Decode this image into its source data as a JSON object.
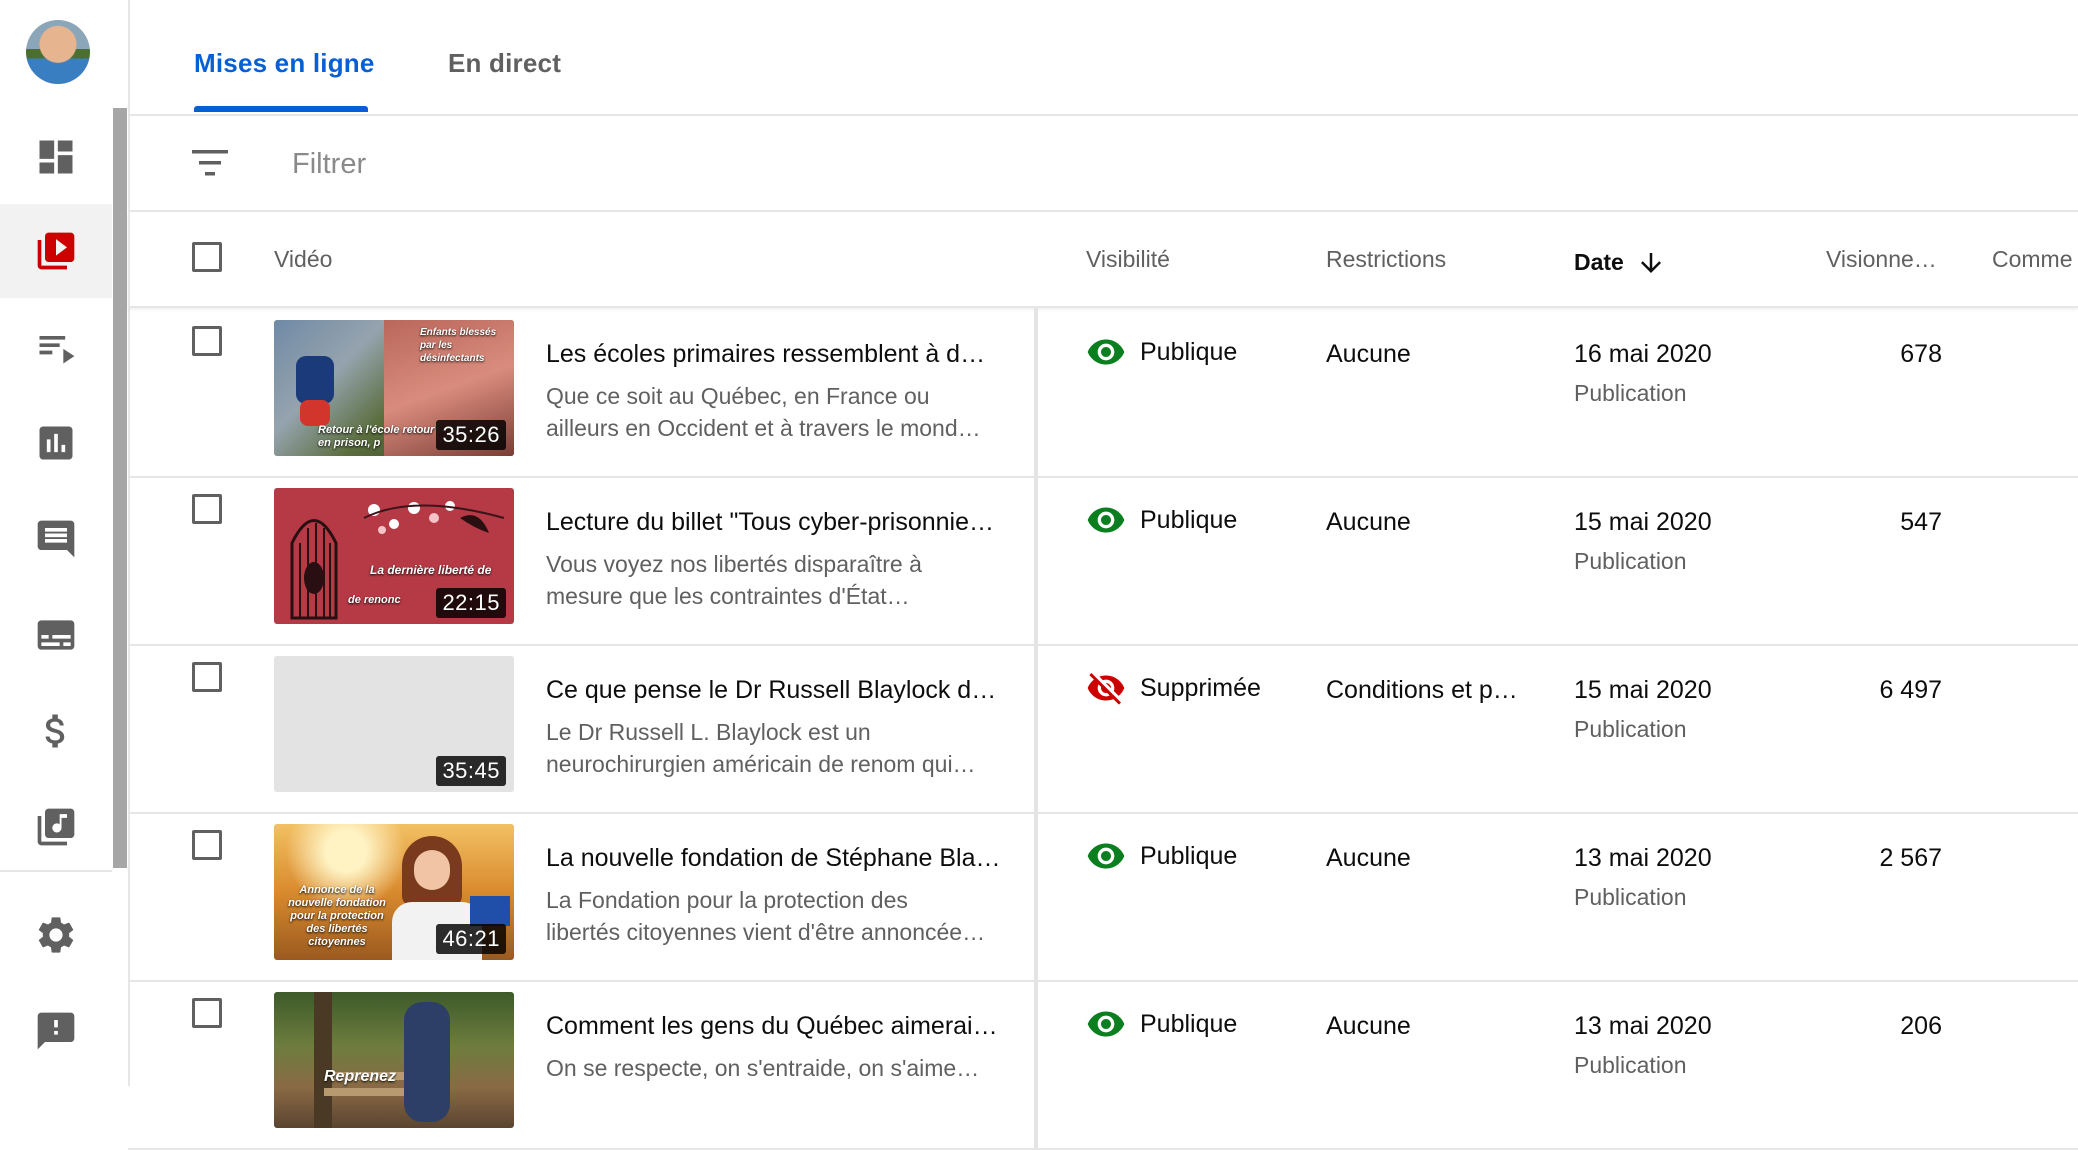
{
  "nav": {
    "items": [
      {
        "name": "dashboard",
        "icon": "dashboard-icon"
      },
      {
        "name": "content",
        "icon": "video-library-icon",
        "active": true
      },
      {
        "name": "playlists",
        "icon": "playlist-icon"
      },
      {
        "name": "analytics",
        "icon": "analytics-icon"
      },
      {
        "name": "comments",
        "icon": "comments-icon"
      },
      {
        "name": "subtitles",
        "icon": "subtitles-icon"
      },
      {
        "name": "monetization",
        "icon": "dollar-icon"
      },
      {
        "name": "audio-library",
        "icon": "audio-library-icon"
      },
      {
        "name": "settings",
        "icon": "gear-icon"
      },
      {
        "name": "feedback",
        "icon": "feedback-icon"
      }
    ]
  },
  "tabs": [
    {
      "label": "Mises en ligne",
      "active": true
    },
    {
      "label": "En direct",
      "active": false
    }
  ],
  "filter": {
    "placeholder": "Filtrer",
    "icon": "filter-icon"
  },
  "table": {
    "headers": {
      "video": "Vidéo",
      "visibility": "Visibilité",
      "restrictions": "Restrictions",
      "date": "Date",
      "views": "Visionne…",
      "comments": "Comme"
    },
    "rows": [
      {
        "title": "Les écoles primaires ressemblent à d…",
        "desc1": "Que ce soit au Québec, en France ou",
        "desc2": "ailleurs en Occident et à travers le mond…",
        "duration": "35:26",
        "visibility": "Publique",
        "restrictions": "Aucune",
        "date": "16 mai 2020",
        "date_sub": "Publication",
        "views": "678",
        "thumb_caption_1": "Enfants blessés par les désinfectants",
        "thumb_caption_2": "Retour à l'école retour en prison, p"
      },
      {
        "title": "Lecture du billet \"Tous cyber-prisonnie…",
        "desc1": "Vous voyez nos libertés disparaître à",
        "desc2": "mesure que les contraintes d'État…",
        "duration": "22:15",
        "visibility": "Publique",
        "restrictions": "Aucune",
        "date": "15 mai 2020",
        "date_sub": "Publication",
        "views": "547",
        "thumb_caption_1": "La dernière liberté de",
        "thumb_caption_2": "de renonc"
      },
      {
        "title": "Ce que pense le Dr Russell Blaylock d…",
        "desc1": "Le Dr Russell L. Blaylock est un",
        "desc2": "neurochirurgien américain de renom qui…",
        "duration": "35:45",
        "visibility": "Supprimée",
        "restrictions": "Conditions et p…",
        "date": "15 mai 2020",
        "date_sub": "Publication",
        "views": "6 497"
      },
      {
        "title": "La nouvelle fondation de Stéphane Bla…",
        "desc1": "La Fondation pour la protection des",
        "desc2": "libertés citoyennes vient d'être annoncée…",
        "duration": "46:21",
        "visibility": "Publique",
        "restrictions": "Aucune",
        "date": "13 mai 2020",
        "date_sub": "Publication",
        "views": "2 567",
        "thumb_caption_1": "Annonce de la nouvelle fondation pour la protection des libertés citoyennes"
      },
      {
        "title": "Comment les gens du Québec aimerai…",
        "desc1": "On se respecte, on s'entraide, on s'aime…",
        "desc2": "",
        "duration": "",
        "visibility": "Publique",
        "restrictions": "Aucune",
        "date": "13 mai 2020",
        "date_sub": "Publication",
        "views": "206",
        "thumb_caption_1": "Reprenez"
      }
    ]
  },
  "colors": {
    "accent": "#065fd4",
    "public": "#0b7f1f",
    "removed": "#cc0000",
    "brand_red": "#cc0000"
  }
}
